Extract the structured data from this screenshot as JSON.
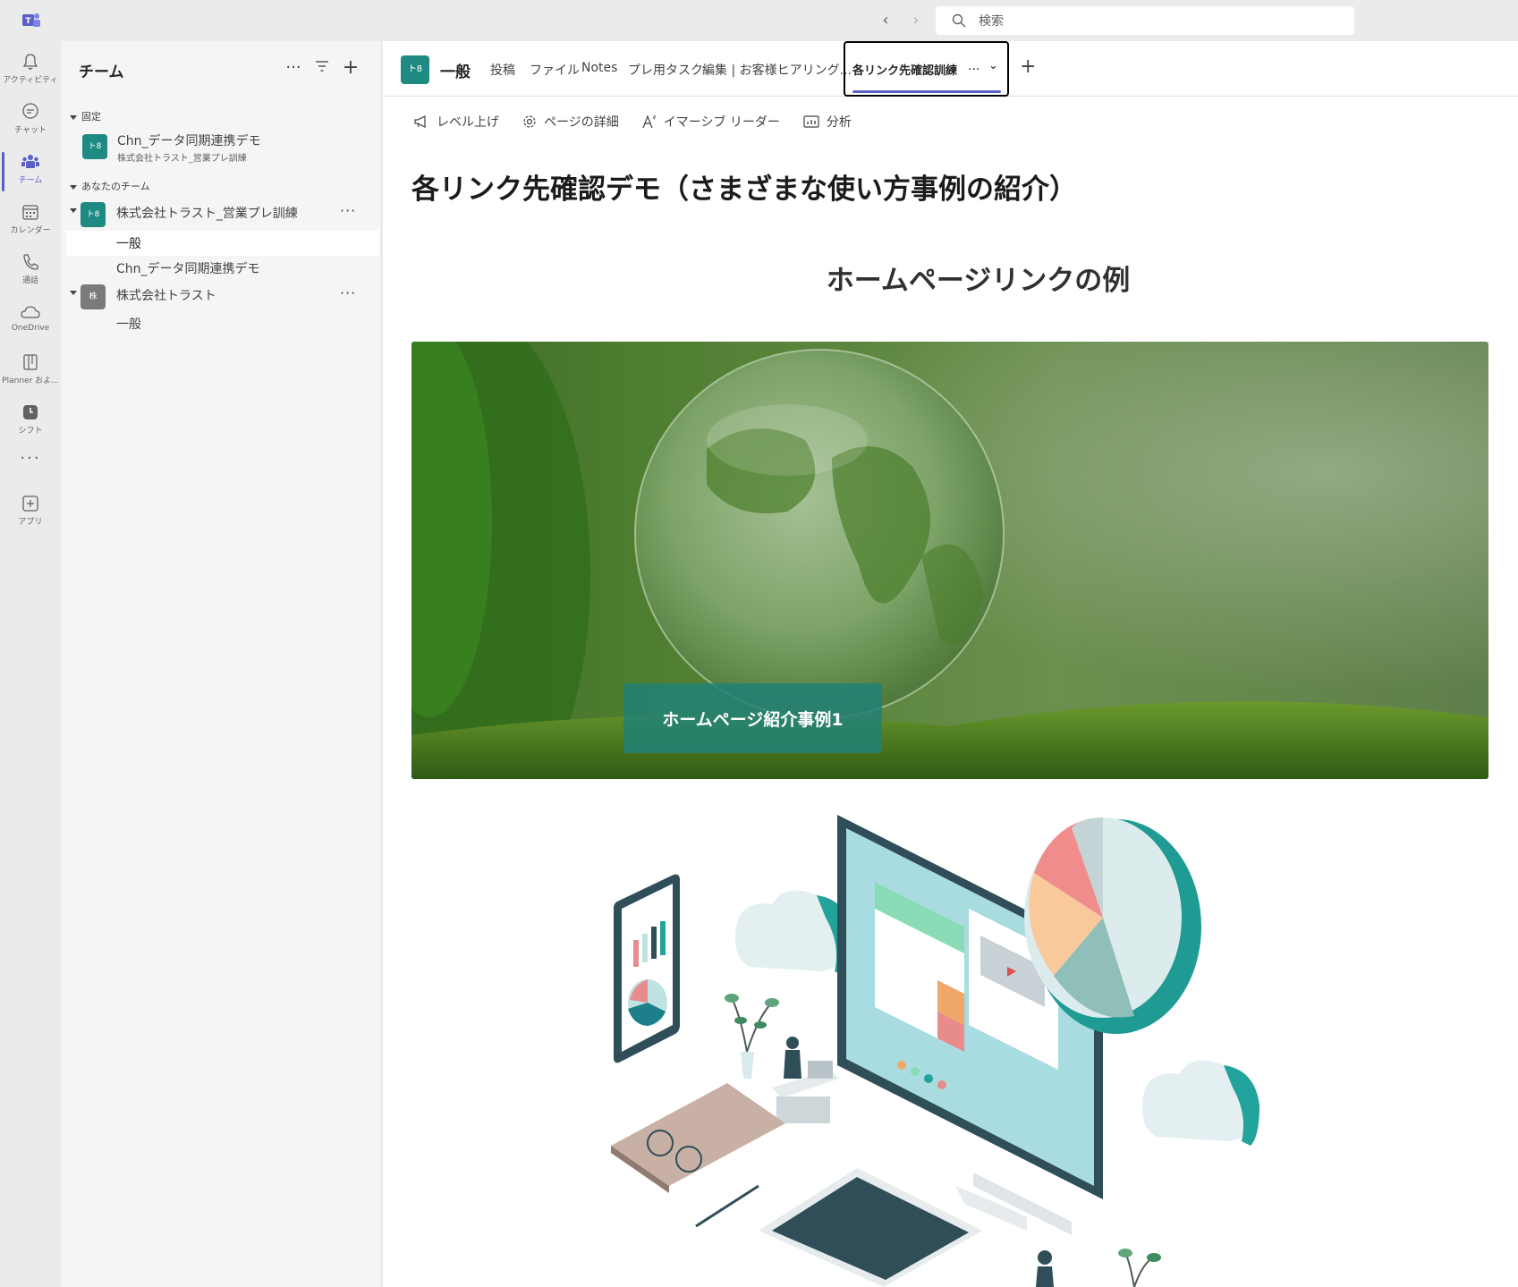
{
  "topbar": {
    "search_placeholder": "検索"
  },
  "rail": {
    "items": [
      {
        "label": "アクティビティ",
        "icon": "bell-icon"
      },
      {
        "label": "チャット",
        "icon": "chat-icon"
      },
      {
        "label": "チーム",
        "icon": "teams-icon"
      },
      {
        "label": "カレンダー",
        "icon": "calendar-icon"
      },
      {
        "label": "通話",
        "icon": "phone-icon"
      },
      {
        "label": "OneDrive",
        "icon": "cloud-icon"
      },
      {
        "label": "Planner およ...",
        "icon": "planner-icon"
      },
      {
        "label": "シフト",
        "icon": "clock-icon"
      },
      {
        "label": "アプリ",
        "icon": "add-app-icon"
      }
    ]
  },
  "sidebar": {
    "title": "チーム",
    "pinned_label": "固定",
    "pinned_item": {
      "avatar": "ト8",
      "name": "Chn_データ同期連携デモ",
      "team": "株式会社トラスト_営業プレ訓練"
    },
    "your_teams_label": "あなたのチーム",
    "teams": [
      {
        "avatar": "ト8",
        "name": "株式会社トラスト_営業プレ訓練",
        "channels": [
          "一般",
          "Chn_データ同期連携デモ"
        ]
      },
      {
        "avatar": "株",
        "name": "株式会社トラスト",
        "channels": [
          "一般"
        ]
      }
    ]
  },
  "header": {
    "channel_avatar": "ト8",
    "channel_name": "一般",
    "tabs": [
      "投稿",
      "ファイル",
      "Notes",
      "プレ用タスク",
      "編集 | お客様ヒアリング..."
    ],
    "active_tab": "各リンク先確認訓練",
    "active_tab_more": "..."
  },
  "commands": [
    "レベル上げ",
    "ページの詳細",
    "イマーシブ リーダー",
    "分析"
  ],
  "page": {
    "title": "各リンク先確認デモ（さまざまな使い方事例の紹介）",
    "section_title": "ホームページリンクの例",
    "hero_button": "ホームページ紹介事例1"
  },
  "colors": {
    "accent": "#5b5fc7",
    "team_avatar": "#1e8a82",
    "team_avatar_gray": "#7a7a7a",
    "hero_button_bg": "#228076"
  }
}
